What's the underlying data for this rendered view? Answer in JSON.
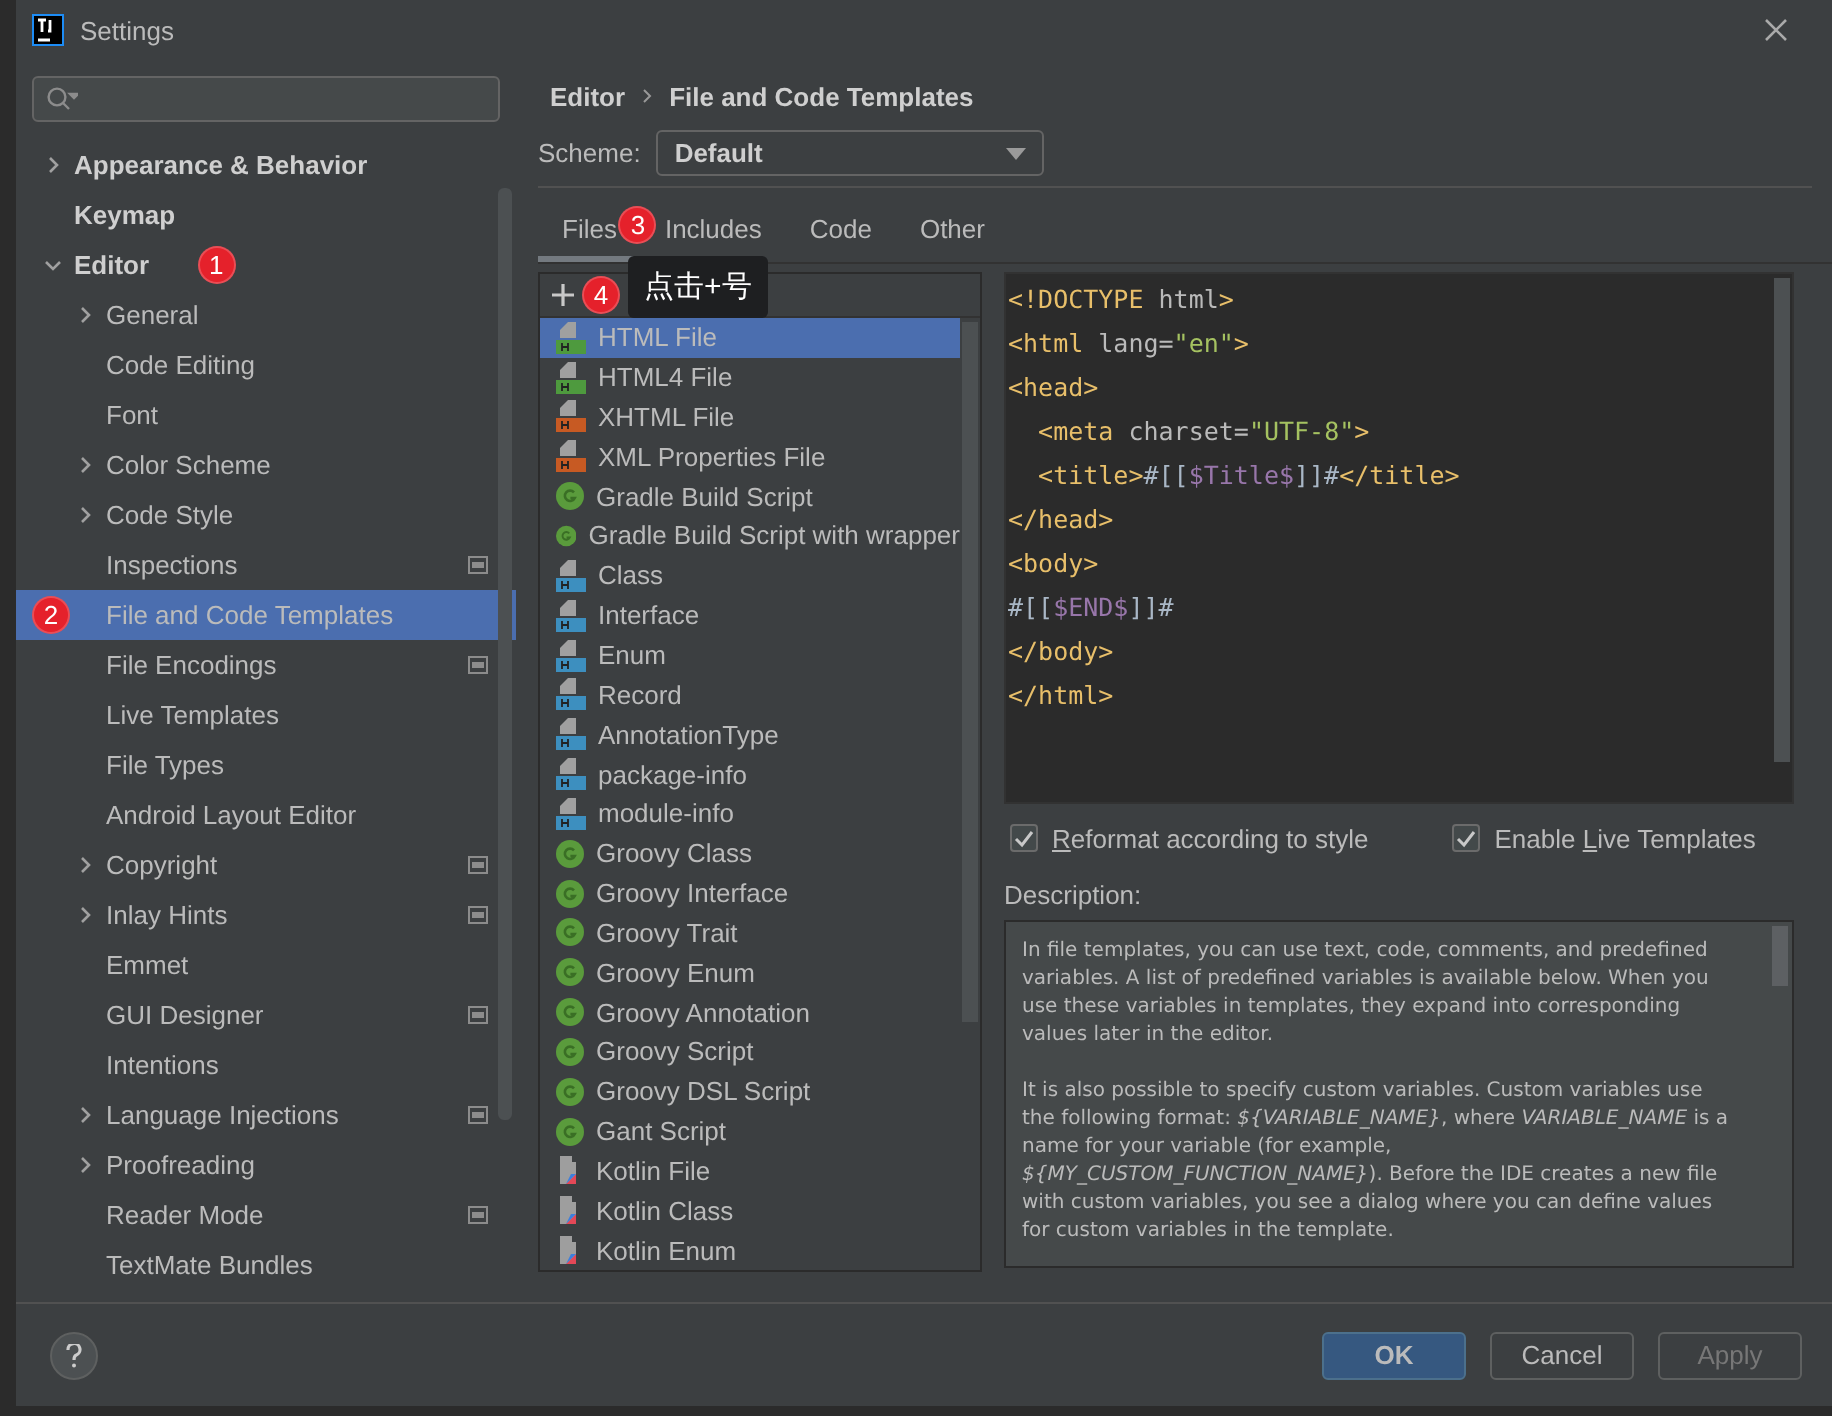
{
  "window": {
    "title": "Settings"
  },
  "sidebar": {
    "items": [
      {
        "label": "Appearance & Behavior",
        "expanded": false
      },
      {
        "label": "Keymap"
      },
      {
        "label": "Editor",
        "expanded": true,
        "annotation": "1",
        "children": [
          {
            "label": "General",
            "expanded": false
          },
          {
            "label": "Code Editing"
          },
          {
            "label": "Font"
          },
          {
            "label": "Color Scheme",
            "expanded": false
          },
          {
            "label": "Code Style",
            "expanded": false
          },
          {
            "label": "Inspections",
            "project": true
          },
          {
            "label": "File and Code Templates",
            "selected": true,
            "annotation": "2"
          },
          {
            "label": "File Encodings",
            "project": true
          },
          {
            "label": "Live Templates"
          },
          {
            "label": "File Types"
          },
          {
            "label": "Android Layout Editor"
          },
          {
            "label": "Copyright",
            "expanded": false,
            "project": true
          },
          {
            "label": "Inlay Hints",
            "expanded": false,
            "project": true
          },
          {
            "label": "Emmet"
          },
          {
            "label": "GUI Designer",
            "project": true
          },
          {
            "label": "Intentions"
          },
          {
            "label": "Language Injections",
            "expanded": false,
            "project": true
          },
          {
            "label": "Proofreading",
            "expanded": false
          },
          {
            "label": "Reader Mode",
            "project": true
          },
          {
            "label": "TextMate Bundles"
          }
        ]
      }
    ]
  },
  "breadcrumb": [
    "Editor",
    "File and Code Templates"
  ],
  "scheme": {
    "label": "Scheme:",
    "value": "Default"
  },
  "tabs": [
    {
      "label": "Files",
      "selected": true,
      "annotation": "3"
    },
    {
      "label": "Includes",
      "selected": false
    },
    {
      "label": "Code",
      "selected": false
    },
    {
      "label": "Other",
      "selected": false
    }
  ],
  "toolbar": {
    "annotation": "4",
    "tooltip": "点击+号"
  },
  "templates": [
    {
      "label": "HTML File",
      "kind": "html",
      "selected": true
    },
    {
      "label": "HTML4 File",
      "kind": "html",
      "selected": false
    },
    {
      "label": "XHTML File",
      "kind": "xhtml",
      "selected": false
    },
    {
      "label": "XML Properties File",
      "kind": "xml",
      "selected": false
    },
    {
      "label": "Gradle Build Script",
      "kind": "gradle",
      "selected": false
    },
    {
      "label": "Gradle Build Script with wrapper",
      "kind": "gradle",
      "selected": false
    },
    {
      "label": "Class",
      "kind": "java",
      "selected": false
    },
    {
      "label": "Interface",
      "kind": "java",
      "selected": false
    },
    {
      "label": "Enum",
      "kind": "java",
      "selected": false
    },
    {
      "label": "Record",
      "kind": "java",
      "selected": false
    },
    {
      "label": "AnnotationType",
      "kind": "java",
      "selected": false
    },
    {
      "label": "package-info",
      "kind": "java",
      "selected": false
    },
    {
      "label": "module-info",
      "kind": "java",
      "selected": false
    },
    {
      "label": "Groovy Class",
      "kind": "gradle",
      "selected": false
    },
    {
      "label": "Groovy Interface",
      "kind": "gradle",
      "selected": false
    },
    {
      "label": "Groovy Trait",
      "kind": "gradle",
      "selected": false
    },
    {
      "label": "Groovy Enum",
      "kind": "gradle",
      "selected": false
    },
    {
      "label": "Groovy Annotation",
      "kind": "gradle",
      "selected": false
    },
    {
      "label": "Groovy Script",
      "kind": "gradle",
      "selected": false
    },
    {
      "label": "Groovy DSL Script",
      "kind": "gradle",
      "selected": false
    },
    {
      "label": "Gant Script",
      "kind": "gradle",
      "selected": false
    },
    {
      "label": "Kotlin File",
      "kind": "kotlin",
      "selected": false
    },
    {
      "label": "Kotlin Class",
      "kind": "kotlin",
      "selected": false
    },
    {
      "label": "Kotlin Enum",
      "kind": "kotlin",
      "selected": false
    }
  ],
  "code_lines": [
    [
      {
        "kind": "tag",
        "text": "<!DOCTYPE "
      },
      {
        "kind": "attr",
        "text": "html"
      },
      {
        "kind": "tag",
        "text": ">"
      }
    ],
    [
      {
        "kind": "tag",
        "text": "<html "
      },
      {
        "kind": "attr",
        "text": "lang="
      },
      {
        "kind": "value",
        "text": "\"en\""
      },
      {
        "kind": "tag",
        "text": ">"
      }
    ],
    [
      {
        "kind": "tag",
        "text": "<head>"
      }
    ],
    [
      {
        "kind": "tag",
        "text": "  <meta "
      },
      {
        "kind": "attr",
        "text": "charset="
      },
      {
        "kind": "value",
        "text": "\"UTF-8\""
      },
      {
        "kind": "tag",
        "text": ">"
      }
    ],
    [
      {
        "kind": "tag",
        "text": "  <title>"
      },
      {
        "kind": "text",
        "text": "#[["
      },
      {
        "kind": "var",
        "text": "$Title$"
      },
      {
        "kind": "text",
        "text": "]]#"
      },
      {
        "kind": "tag",
        "text": "</title>"
      }
    ],
    [
      {
        "kind": "tag",
        "text": "</head>"
      }
    ],
    [
      {
        "kind": "tag",
        "text": "<body>"
      }
    ],
    [
      {
        "kind": "text",
        "text": "#[["
      },
      {
        "kind": "var",
        "text": "$END$"
      },
      {
        "kind": "text",
        "text": "]]#"
      }
    ],
    [
      {
        "kind": "tag",
        "text": "</body>"
      }
    ],
    [
      {
        "kind": "tag",
        "text": "</html>"
      }
    ]
  ],
  "options": [
    {
      "key": "R",
      "after": "eformat according to style",
      "checked": true
    },
    {
      "before": "Enable ",
      "key": "L",
      "after": "ive Templates",
      "checked": true
    }
  ],
  "description": {
    "label": "Description:",
    "paragraphs": [
      "In file templates, you can use text, code, comments, and predefined variables. A list of predefined variables is available below. When you use these variables in templates, they expand into corresponding values later in the editor.",
      "It is also possible to specify custom variables. Custom variables use the following format: *${VARIABLE_NAME}*, where *VARIABLE_NAME* is a name for your variable (for example, *${MY_CUSTOM_FUNCTION_NAME}*). Before the IDE creates a new file with custom variables, you see a dialog where you can define values for custom variables in the template."
    ]
  },
  "buttons": [
    {
      "label": "OK",
      "kind": "primary"
    },
    {
      "label": "Cancel",
      "kind": "normal"
    },
    {
      "label": "Apply",
      "kind": "disabled"
    }
  ]
}
